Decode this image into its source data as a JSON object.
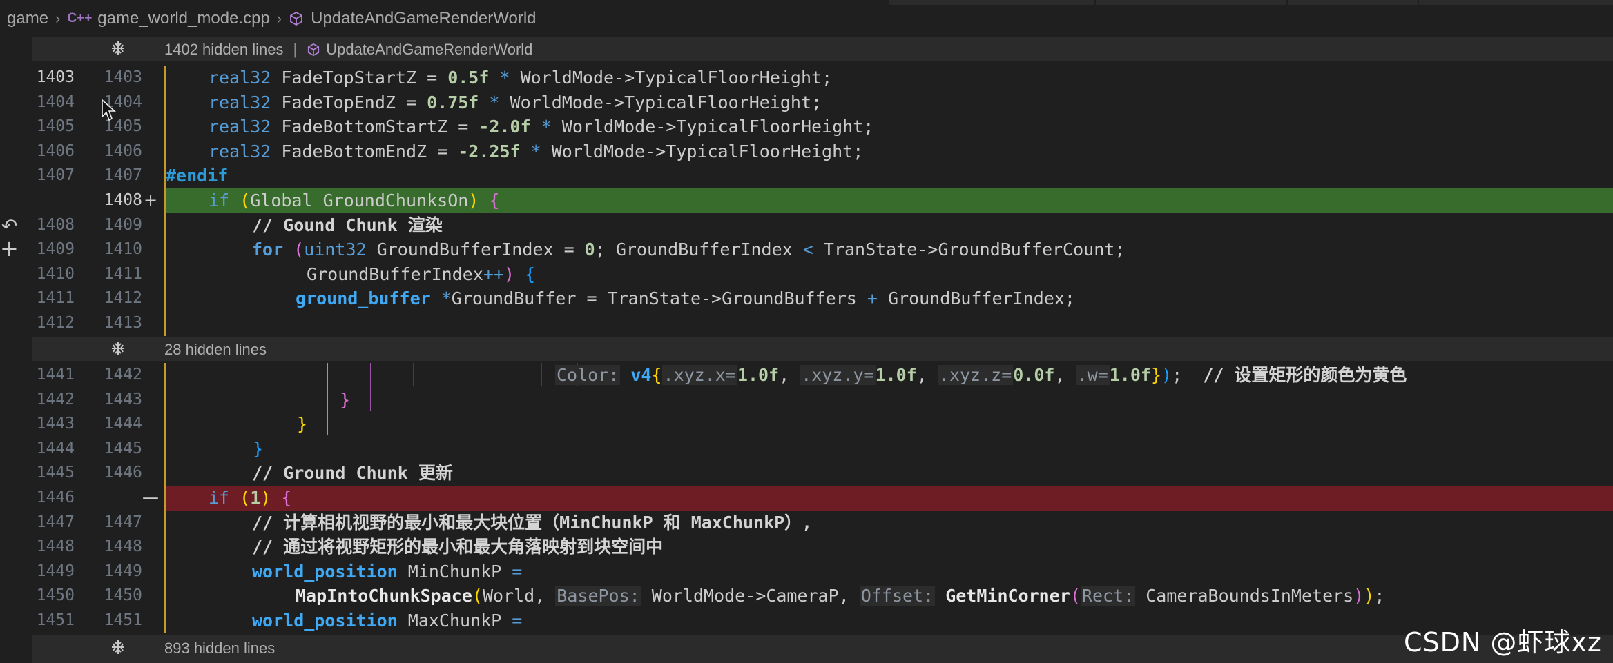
{
  "breadcrumb": {
    "folder": "game",
    "lang_badge": "C++",
    "file": "game_world_mode.cpp",
    "symbol": "UpdateAndGameRenderWorld"
  },
  "folds": [
    {
      "count_text": "1402 hidden lines",
      "symbol": "UpdateAndGameRenderWorld"
    },
    {
      "count_text": "28 hidden lines"
    },
    {
      "count_text": "893 hidden lines"
    }
  ],
  "lines": {
    "l1403": {
      "left": "1403",
      "right": "1403"
    },
    "l1404": {
      "left": "1404",
      "right": "1404"
    },
    "l1405": {
      "left": "1405",
      "right": "1405"
    },
    "l1406": {
      "left": "1406",
      "right": "1406"
    },
    "l1407": {
      "left": "1407",
      "right": "1407"
    },
    "l1408add": {
      "left": "",
      "right": "1408",
      "marker": "+"
    },
    "l1409": {
      "left": "1408",
      "right": "1409"
    },
    "l1410": {
      "left": "1409",
      "right": "1410"
    },
    "l1411": {
      "left": "1410",
      "right": "1411"
    },
    "l1412": {
      "left": "1411",
      "right": "1412"
    },
    "l1413": {
      "left": "1412",
      "right": "1413"
    },
    "l1442": {
      "left": "1441",
      "right": "1442"
    },
    "l1443": {
      "left": "1442",
      "right": "1443"
    },
    "l1444": {
      "left": "1443",
      "right": "1444"
    },
    "l1445": {
      "left": "1444",
      "right": "1445"
    },
    "l1446": {
      "left": "1445",
      "right": "1446"
    },
    "l1446del": {
      "left": "1446",
      "right": "",
      "marker": "—"
    },
    "l1447": {
      "left": "1447",
      "right": "1447"
    },
    "l1448": {
      "left": "1448",
      "right": "1448"
    },
    "l1449": {
      "left": "1449",
      "right": "1449"
    },
    "l1450": {
      "left": "1450",
      "right": "1450"
    },
    "l1451": {
      "left": "1451",
      "right": "1451"
    }
  },
  "code": {
    "c1403": {
      "t": "real32",
      "v": " FadeTopStartZ ",
      "eq": "=",
      "n": " 0.5f",
      "m": " *",
      "r": " WorldMode->TypicalFloorHeight;"
    },
    "c1404": {
      "t": "real32",
      "v": " FadeTopEndZ ",
      "eq": "=",
      "n": " 0.75f",
      "m": " *",
      "r": " WorldMode->TypicalFloorHeight;"
    },
    "c1405": {
      "t": "real32",
      "v": " FadeBottomStartZ ",
      "eq": "=",
      "n": " -2.0f",
      "m": " *",
      "r": " WorldMode->TypicalFloorHeight;"
    },
    "c1406": {
      "t": "real32",
      "v": " FadeBottomEndZ ",
      "eq": "=",
      "n": " -2.25f",
      "m": " *",
      "r": " WorldMode->TypicalFloorHeight;"
    },
    "c1407": {
      "pp": "#endif"
    },
    "c1408": {
      "kw": "if",
      "ob": " (",
      "cond": "Global_GroundChunksOn",
      "cb": ")",
      "brace": " {"
    },
    "c1409": {
      "cmt": "// Gound Chunk 渲染"
    },
    "c1410": {
      "kw": "for",
      "ob": " (",
      "t": "uint32",
      "a": " GroundBufferIndex ",
      "eq": "=",
      "n": " 0",
      "b": "; GroundBufferIndex ",
      "lt": "<",
      "c": " TranState->GroundBufferCount;"
    },
    "c1411": {
      "a": "GroundBufferIndex",
      "inc": "++",
      "cb": ")",
      "brace": " {"
    },
    "c1412": {
      "t": "ground_buffer",
      "star": " *",
      "a": "GroundBuffer ",
      "eq": "=",
      "b": " TranState->GroundBuffers ",
      "plus": "+",
      "c": " GroundBufferIndex;"
    },
    "c1442": {
      "h1": "Color:",
      "fn": " v4",
      "ob": "{",
      "h2": ".xyz.x=",
      "n1": "1.0f",
      "s1": ", ",
      "h3": ".xyz.y=",
      "n2": "1.0f",
      "s2": ", ",
      "h4": ".xyz.z=",
      "n3": "0.0f",
      "s3": ", ",
      "h5": ".w=",
      "n4": "1.0f",
      "cb": "}",
      "cp": ")",
      "semi": ";",
      "cmt": "  // 设置矩形的颜色为黄色"
    },
    "c1443": {
      "brace": "}"
    },
    "c1444": {
      "brace": "}"
    },
    "c1445": {
      "brace": "}"
    },
    "c1446": {
      "cmt": "// Ground Chunk 更新"
    },
    "c1446del": {
      "kw": "if",
      "ob": " (",
      "n": "1",
      "cb": ")",
      "brace": " {"
    },
    "c1447": {
      "cmt": "// 计算相机视野的最小和最大块位置（MinChunkP 和 MaxChunkP）,"
    },
    "c1448": {
      "cmt": "// 通过将视野矩形的最小和最大角落映射到块空间中"
    },
    "c1449": {
      "t": "world_position",
      "a": " MinChunkP ",
      "eq": "="
    },
    "c1450": {
      "fn": "MapIntoChunkSpace",
      "ob": "(",
      "a": "World, ",
      "h1": "BasePos:",
      "b": " WorldMode->CameraP, ",
      "h2": "Offset:",
      "fn2": " GetMinCorner",
      "ob2": "(",
      "h3": "Rect:",
      "c": " CameraBoundsInMeters",
      "cb2": ")",
      "cb": ")",
      "semi": ";"
    },
    "c1451": {
      "t": "world_position",
      "a": " MaxChunkP ",
      "eq": "="
    }
  },
  "watermark": "CSDN @虾球xz"
}
